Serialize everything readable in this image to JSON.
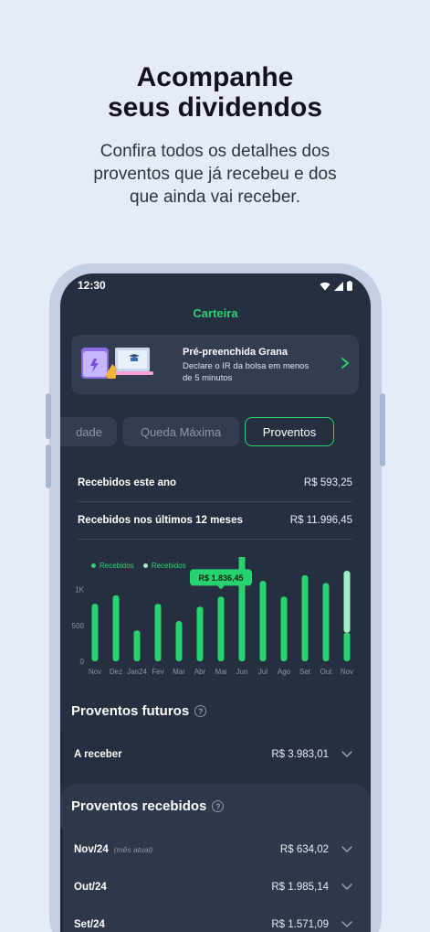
{
  "hero": {
    "title_line1": "Acompanhe",
    "title_line2": "seus dividendos",
    "sub_line1": "Confira todos os detalhes dos",
    "sub_line2": "proventos que já recebeu e dos",
    "sub_line3": "que ainda vai receber."
  },
  "status_bar": {
    "time": "12:30"
  },
  "header": {
    "title": "Carteira"
  },
  "promo": {
    "title": "Pré-preenchida Grana",
    "desc": "Declare o IR da bolsa em menos de 5 minutos"
  },
  "tabs": [
    {
      "label": "dade"
    },
    {
      "label": "Queda Máxima"
    },
    {
      "label": "Proventos",
      "active": true
    }
  ],
  "summary": [
    {
      "label": "Recebidos este ano",
      "value": "R$ 593,25"
    },
    {
      "label": "Recebidos nos últimos 12 meses",
      "value": "R$ 11.996,45"
    }
  ],
  "chart_data": {
    "type": "bar",
    "title": "",
    "legend": [
      {
        "name": "Recebidos",
        "color": "#27d36f"
      },
      {
        "name": "Recebidos",
        "color": "#9ff0c6"
      }
    ],
    "categories": [
      "Nov",
      "Dez",
      "Jan24",
      "Fev",
      "Mar",
      "Abr",
      "Mai",
      "Jun",
      "Jul",
      "Ago",
      "Set",
      "Out",
      "Nov"
    ],
    "series": [
      {
        "name": "Recebidos",
        "values": [
          800,
          920,
          430,
          800,
          560,
          760,
          900,
          1500,
          1120,
          900,
          1200,
          1090,
          400
        ]
      },
      {
        "name": "Recebidos",
        "values": [
          0,
          0,
          0,
          0,
          0,
          0,
          0,
          0,
          0,
          0,
          0,
          0,
          860
        ]
      }
    ],
    "yticks": [
      "0",
      "500",
      "1K"
    ],
    "ylim": [
      0,
      1300
    ],
    "tooltip": {
      "category": "Mai",
      "label": "R$ 1.836,45"
    },
    "colors": {
      "primary": "#27d36f",
      "secondary": "#9ff0c6"
    }
  },
  "futuros": {
    "title": "Proventos futuros",
    "info_icon": "?",
    "rows": [
      {
        "label": "A receber",
        "value": "R$ 3.983,01"
      }
    ]
  },
  "recebidos": {
    "title": "Proventos recebidos",
    "info_icon": "?",
    "rows": [
      {
        "label": "Nov/24",
        "note": "(mês atual)",
        "value": "R$ 634,02"
      },
      {
        "label": "Out/24",
        "value": "R$ 1.985,14"
      },
      {
        "label": "Set/24",
        "value": "R$ 1.571,09"
      }
    ]
  },
  "colors": {
    "accent": "#27d36f",
    "screen_bg": "#262f40",
    "page_bg": "#e6ecf7"
  }
}
